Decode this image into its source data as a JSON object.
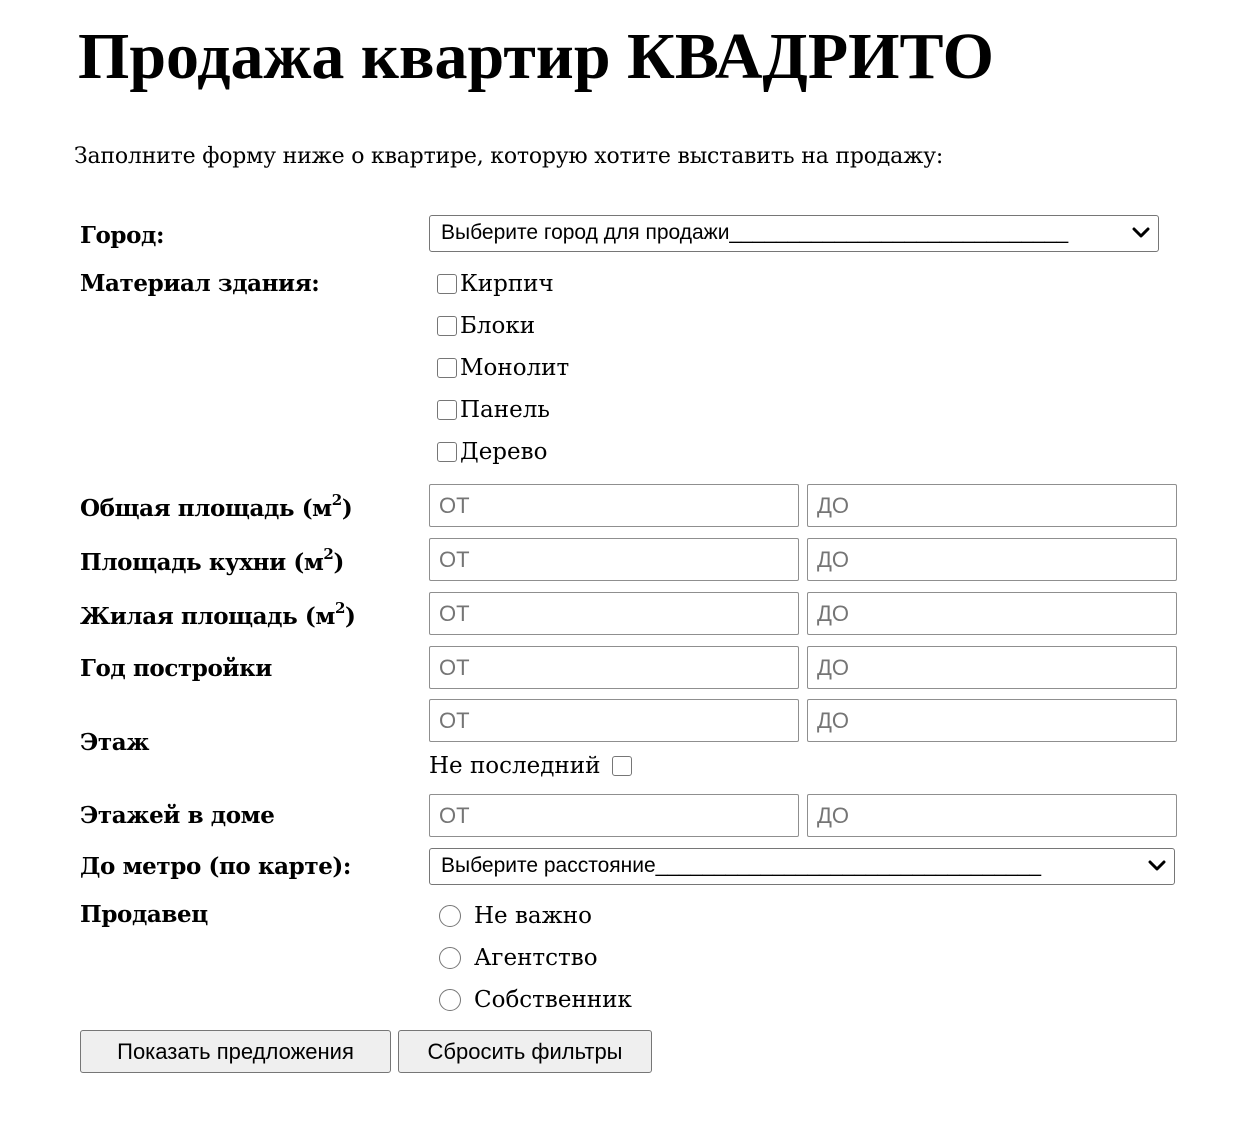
{
  "page": {
    "title": "Продажа квартир КВАДРИТО",
    "intro": "Заполните форму ниже о квартире, которую хотите выставить на продажу:"
  },
  "city": {
    "label": "Город:",
    "selected": "Выберите город для продажи_____________________________"
  },
  "material": {
    "label": "Материал здания:",
    "options": [
      "Кирпич",
      "Блоки",
      "Монолит",
      "Панель",
      "Дерево"
    ]
  },
  "ranges": {
    "from_placeholder": "ОТ",
    "to_placeholder": "ДО",
    "total_area": {
      "label": "Общая площадь (м",
      "unit_exp": "2",
      "label_end": ")"
    },
    "kitchen_area": {
      "label": "Площадь кухни (м",
      "unit_exp": "2",
      "label_end": ")"
    },
    "living_area": {
      "label": "Жилая площадь (м",
      "unit_exp": "2",
      "label_end": ")"
    },
    "year_built": {
      "label": "Год постройки"
    },
    "floor": {
      "label": "Этаж",
      "not_last_label": "Не последний"
    },
    "floors_in_building": {
      "label": "Этажей в доме"
    }
  },
  "metro": {
    "label": "До метро (по карте):",
    "selected": "Выберите расстояние_________________________________"
  },
  "seller": {
    "label": "Продавец",
    "options": [
      "Не важно",
      "Агентство",
      "Собственник"
    ]
  },
  "buttons": {
    "show": "Показать предложения",
    "reset": "Сбросить фильтры"
  }
}
